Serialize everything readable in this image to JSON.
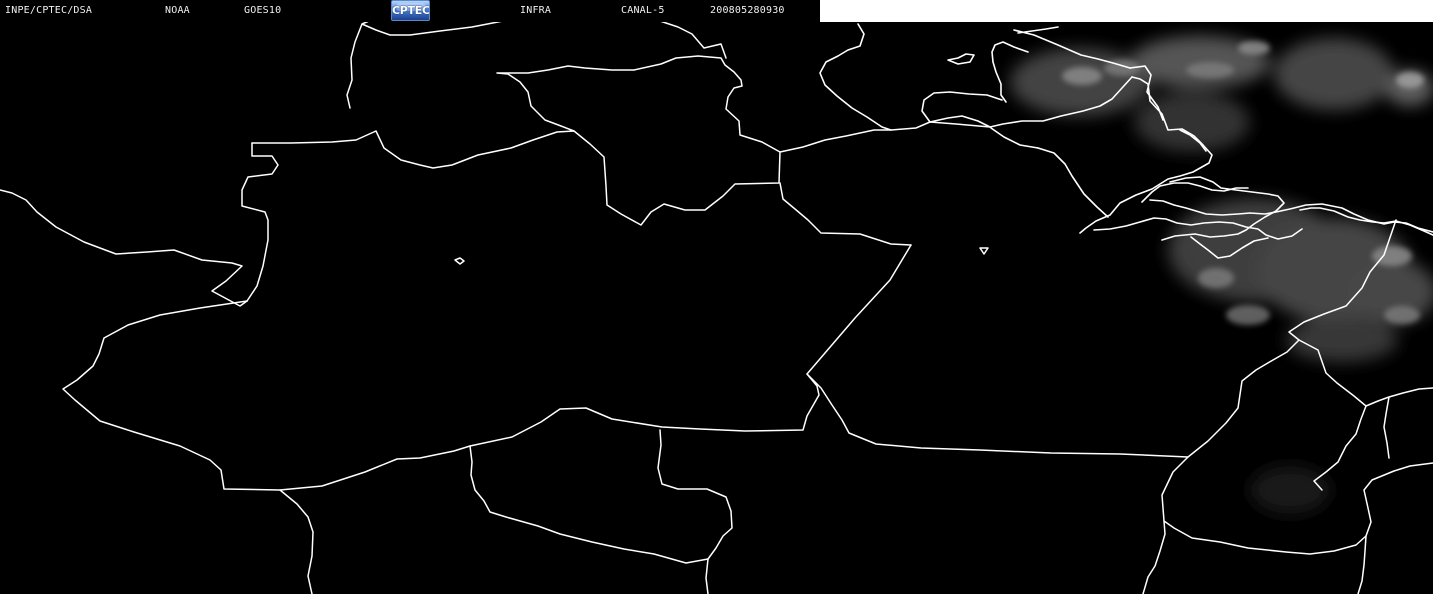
{
  "header": {
    "institution": "INPE/CPTEC/DSA",
    "agency": "NOAA",
    "satellite": "GOES10",
    "logo_text": "CPTEC",
    "product": "INFRA",
    "channel": "CANAL-5",
    "timestamp": "200805280930"
  },
  "colors": {
    "background": "#000000",
    "border_lines": "#ffffff",
    "header_white_strip": "#ffffff",
    "logo_blue": "#4a7fd4"
  }
}
